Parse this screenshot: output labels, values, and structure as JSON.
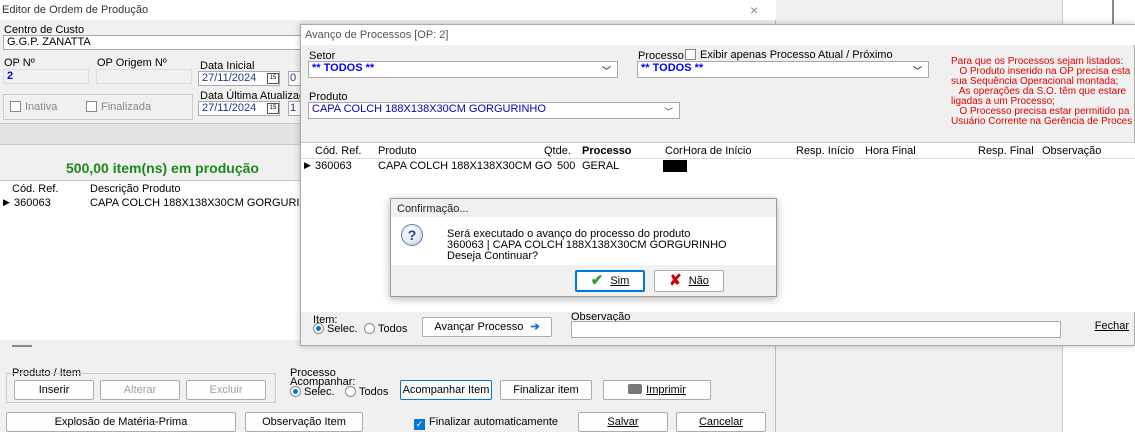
{
  "main": {
    "title": "Editor de Ordem de Produção",
    "cost_center_label": "Centro de Custo",
    "cost_center_value": "G.G.P. ZANATTA",
    "op_label": "OP Nº",
    "op_value": "2",
    "op_origin_label": "OP Origem Nº",
    "start_date_label": "Data Inicial",
    "start_date_value": "27/11/2024",
    "start_time_partial": "0",
    "update_date_label": "Data Última Atualizaç",
    "update_date_value": "27/11/2024",
    "update_time_partial": "1",
    "inactive_label": "Inativa",
    "finished_label": "Finalizada",
    "production_status": "500,00 item(ns) em produção",
    "table_headers": [
      "Cód. Ref.",
      "Descrição Produto"
    ],
    "table_rows": [
      [
        "360063",
        "CAPA COLCH 188X138X30CM GORGURINH"
      ]
    ],
    "product_group_label": "Produto / Item",
    "insert_label": "Inserir",
    "edit_label": "Alterar",
    "delete_label": "Excluir",
    "process_label": "Processo",
    "follow_label": "Acompanhar:",
    "selec_label": "Selec.",
    "todos_label": "Todos",
    "follow_item_label": "Acompanhar Item",
    "finish_item_label": "Finalizar item",
    "print_label": "Imprimir",
    "explosion_label": "Explosão de Matéria-Prima",
    "observation_item_label": "Observação Item",
    "auto_finish_label": "Finalizar automaticamente",
    "save_label": "Salvar",
    "cancel_label": "Cancelar"
  },
  "process_window": {
    "title": "Avanço de Processos [OP: 2]",
    "sector_label": "Setor",
    "sector_value": "** TODOS **",
    "process_label": "Processo",
    "show_current_label": "Exibir apenas Processo Atual / Próximo",
    "process_value": "** TODOS **",
    "product_label": "Produto",
    "product_value": "CAPA COLCH 188X138X30CM GORGURINHO",
    "info_lines": [
      "Para que os Processos sejam listados:",
      "   O Produto inserido na OP precisa esta",
      "sua Sequência Operacional montada;",
      "   As operações da S.O. têm que estare",
      "ligadas a um Processo;",
      "   O Processo precisa estar permitido pa",
      "Usuário Corrente na Gerência de Proces"
    ],
    "table_headers": [
      "Cód. Ref.",
      "Produto",
      "Qtde.",
      "Processo",
      "Cor",
      "Hora de Início",
      "Resp. Início",
      "Hora Final",
      "Resp. Final",
      "Observação"
    ],
    "row": {
      "code": "360063",
      "product": "CAPA COLCH 188X138X30CM GO",
      "qty": "500",
      "process": "GERAL"
    },
    "item_label": "Item:",
    "selec_label": "Selec.",
    "todos_label": "Todos",
    "advance_label": "Avançar Processo",
    "observation_label": "Observação",
    "close_label": "Fechar"
  },
  "dialog": {
    "title": "Confirmação...",
    "line1": "Será executado o avanço do processo do produto",
    "line2": "360063 | CAPA COLCH 188X138X30CM GORGURINHO",
    "line3": "Deseja Continuar?",
    "yes_label": "Sim",
    "no_label": "Não"
  },
  "colors": {
    "production_status": "#1a8a1a",
    "info_text": "#e00000",
    "accent": "#0078d7"
  }
}
